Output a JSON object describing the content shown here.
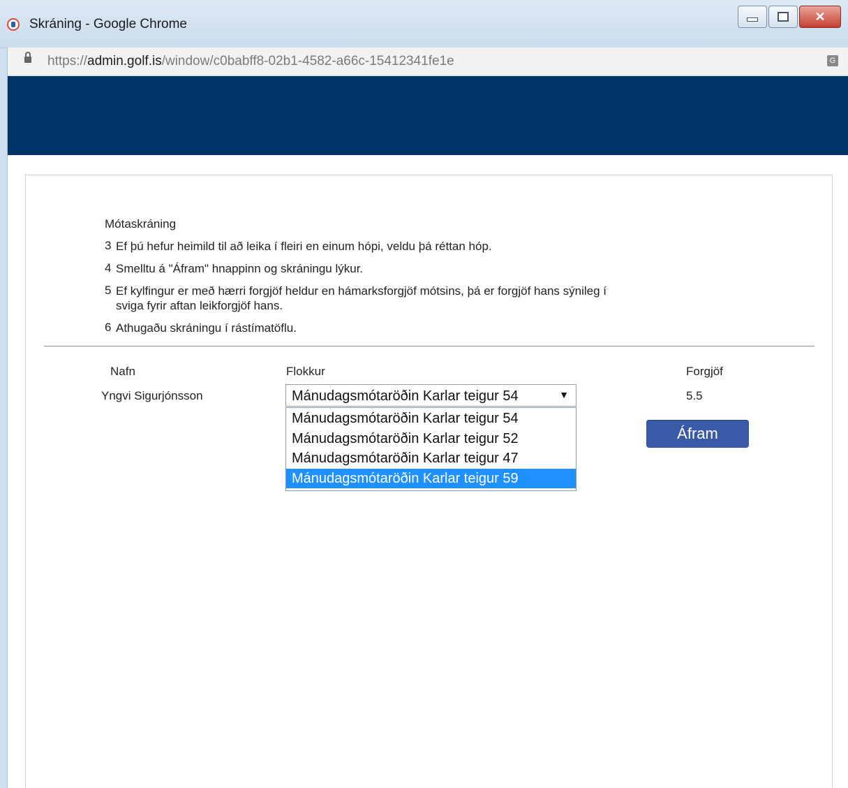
{
  "window": {
    "title": "Skráning - Google Chrome",
    "url_scheme": "https://",
    "url_host": "admin.golf.is",
    "url_path": "/window/c0babff8-02b1-4582-a66c-15412341fe1e"
  },
  "instructions": {
    "title": "Mótaskráning",
    "items": [
      {
        "num": "3",
        "text": "Ef þú hefur heimild til að leika í fleiri en einum hópi, veldu þá réttan hóp."
      },
      {
        "num": "4",
        "text": "Smelltu á \"Áfram\" hnappinn og skráningu lýkur."
      },
      {
        "num": "5",
        "text": "Ef kylfingur er með hærri forgjöf heldur en hámarksforgjöf mótsins, þá er forgjöf hans sýnileg í",
        "text2": "sviga fyrir aftan leikforgjöf hans."
      },
      {
        "num": "6",
        "text": "Athugaðu skráningu í rástímatöflu."
      }
    ]
  },
  "table": {
    "headers": {
      "name": "Nafn",
      "group": "Flokkur",
      "handicap": "Forgjöf"
    },
    "row": {
      "name": "Yngvi Sigurjónsson",
      "selected_group": "Mánudagsmótaröðin Karlar teigur 54",
      "handicap": "5.5"
    },
    "options": [
      "Mánudagsmótaröðin Karlar teigur 54",
      "Mánudagsmótaröðin Karlar teigur 52",
      "Mánudagsmótaröðin Karlar teigur 47",
      "Mánudagsmótaröðin Karlar teigur 59"
    ],
    "highlighted_option_index": 3
  },
  "buttons": {
    "continue": "Áfram"
  },
  "colors": {
    "banner": "#003366",
    "button": "#3a5aa8",
    "highlight": "#1e90ff"
  }
}
